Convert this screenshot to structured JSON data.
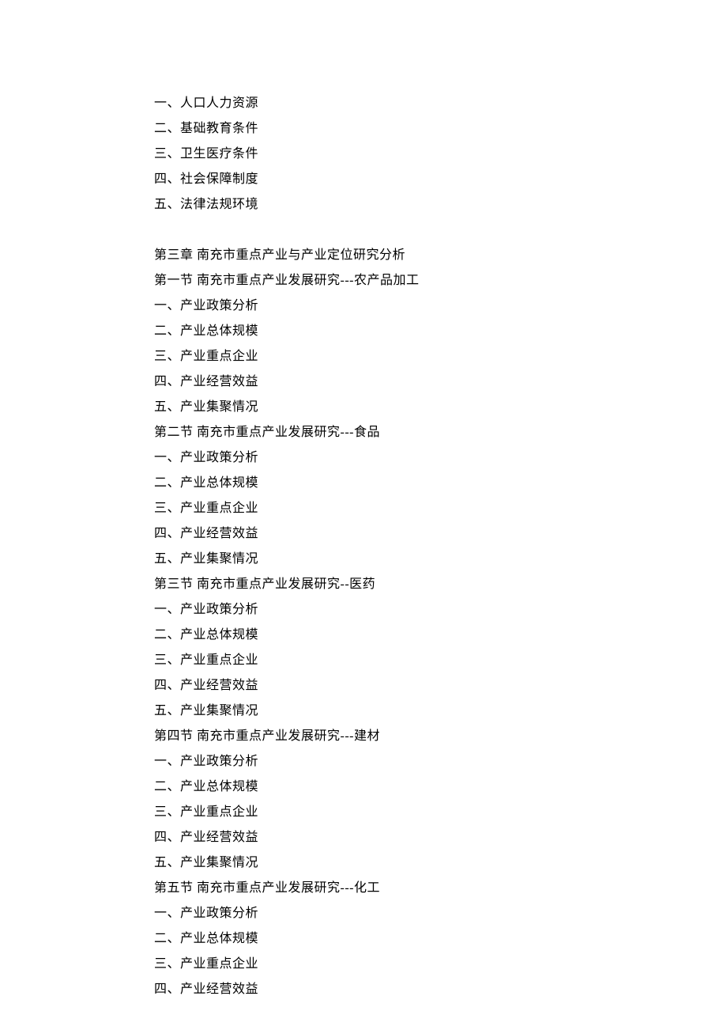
{
  "lines": [
    "一、人口人力资源",
    "二、基础教育条件",
    "三、卫生医疗条件",
    "四、社会保障制度",
    "五、法律法规环境",
    "",
    "第三章  南充市重点产业与产业定位研究分析",
    "第一节  南充市重点产业发展研究---农产品加工",
    "一、产业政策分析",
    "二、产业总体规模",
    "三、产业重点企业",
    "四、产业经营效益",
    "五、产业集聚情况",
    "第二节  南充市重点产业发展研究---食品",
    "一、产业政策分析",
    "二、产业总体规模",
    "三、产业重点企业",
    "四、产业经营效益",
    "五、产业集聚情况",
    "第三节  南充市重点产业发展研究--医药",
    "一、产业政策分析",
    "二、产业总体规模",
    "三、产业重点企业",
    "四、产业经营效益",
    "五、产业集聚情况",
    "第四节  南充市重点产业发展研究---建材",
    "一、产业政策分析",
    "二、产业总体规模",
    "三、产业重点企业",
    "四、产业经营效益",
    "五、产业集聚情况",
    "第五节  南充市重点产业发展研究---化工",
    "一、产业政策分析",
    "二、产业总体规模",
    "三、产业重点企业",
    "四、产业经营效益"
  ]
}
